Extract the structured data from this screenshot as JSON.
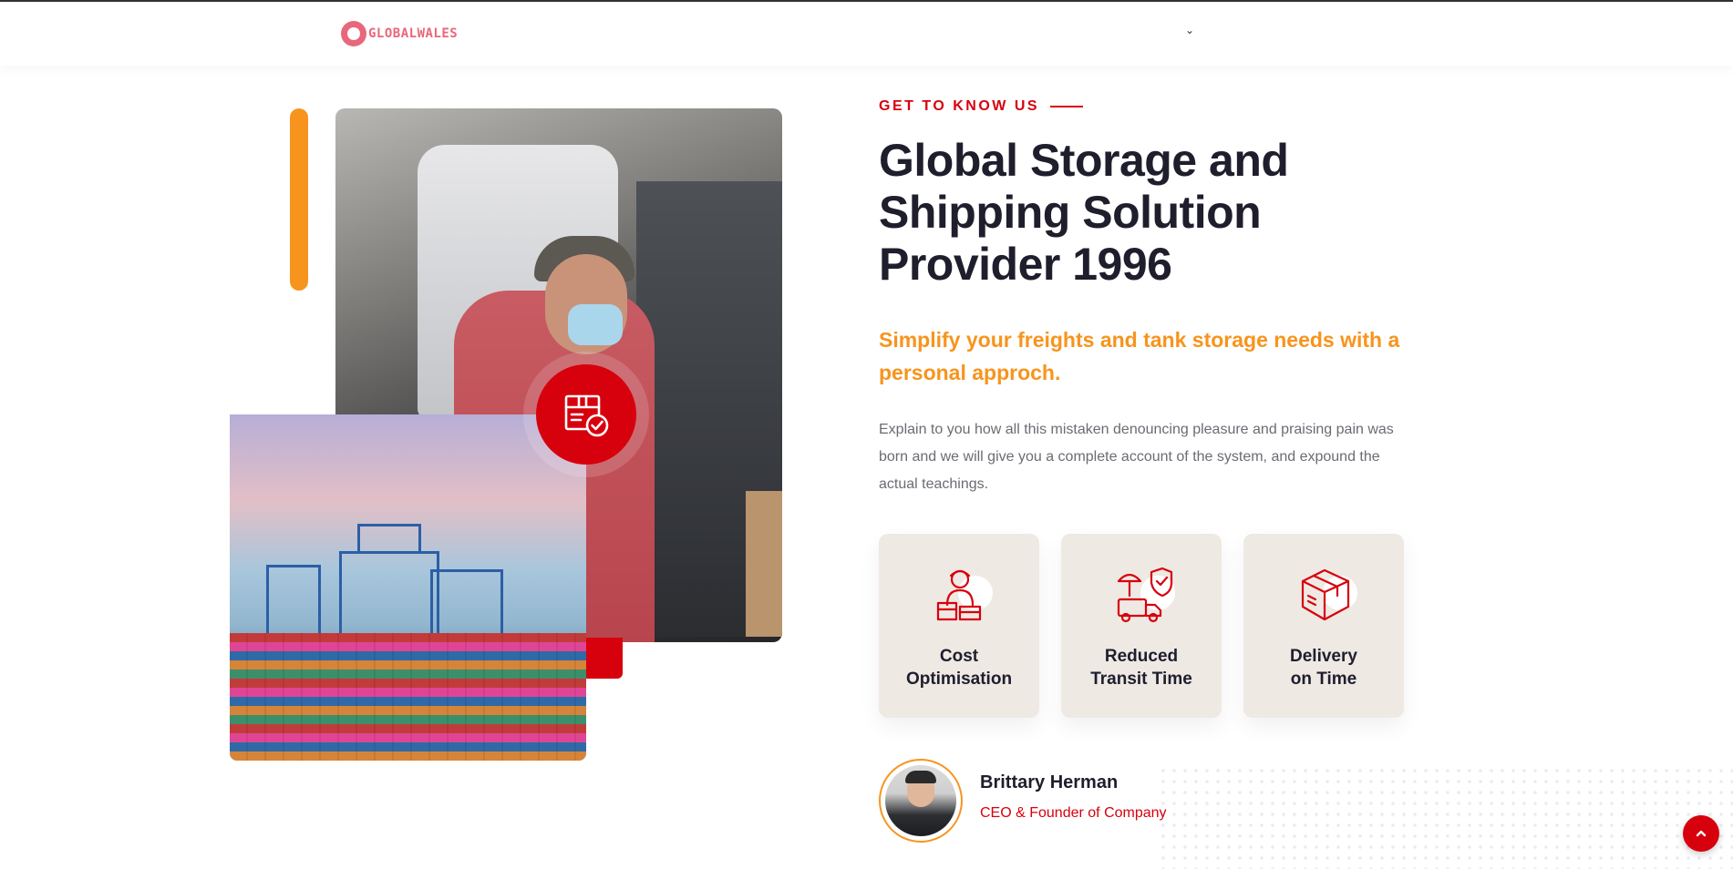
{
  "header": {
    "logo_text": "GLOBALWALES",
    "menu_caret": "⌄"
  },
  "about": {
    "eyebrow": "GET TO KNOW US",
    "title": "Global Storage and Shipping Solution Provider 1996",
    "subtitle": "Simplify your freights and tank storage needs with a personal approch.",
    "paragraph": "Explain to you how all this mistaken denouncing pleasure and praising pain was born and we will give you a complete account of the system, and expound the actual teachings.",
    "features": [
      {
        "icon": "courier-packages-icon",
        "label": "Cost\nOptimisation"
      },
      {
        "icon": "delivery-truck-umbrella-icon",
        "label": "Reduced\nTransit Time"
      },
      {
        "icon": "package-box-icon",
        "label": "Delivery\non Time"
      }
    ],
    "person": {
      "name": "Brittary Herman",
      "role": "CEO & Founder of Company"
    }
  },
  "badge_icon": "package-checklist-icon",
  "scroll_top_icon": "chevron-up-icon",
  "colors": {
    "brand_red": "#d7000d",
    "accent_orange": "#f7941d",
    "heading": "#1e1e2d",
    "feature_bg": "#efe9e4",
    "logo_pink": "#e8677a"
  }
}
